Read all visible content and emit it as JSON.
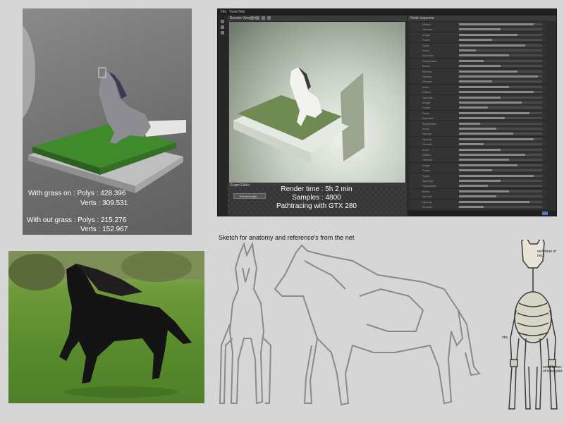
{
  "viewport_stats": {
    "with_grass_polys": "With grass on : Polys : 428.396",
    "with_grass_verts": "Verts : 309.531",
    "without_grass_polys": "With out grass : Polys : 215.276",
    "without_grass_verts": "Verts : 152.967"
  },
  "render_app": {
    "menu": [
      "File",
      "Tools",
      "Help"
    ],
    "viewer_title": "Render Viewport",
    "editor_title": "Node Inspector",
    "graph_title": "Graph Editor",
    "graph_node": "Render target",
    "render_time": "Render time : 5h 2 min",
    "samples": "Samples : 4800",
    "pathtracing": "Pathtracing with GTX 280",
    "editor_rows": [
      {
        "label": "Diffuse",
        "fill": 0.9
      },
      {
        "label": "Gamma",
        "fill": 0.5
      },
      {
        "label": "Image",
        "fill": 0.7
      },
      {
        "label": "Power",
        "fill": 0.4
      },
      {
        "label": "Scale",
        "fill": 0.8
      },
      {
        "label": "Invert",
        "fill": 0.2
      },
      {
        "label": "Specular",
        "fill": 0.6
      },
      {
        "label": "Roughness",
        "fill": 0.3
      },
      {
        "label": "Bump",
        "fill": 0.5
      },
      {
        "label": "Normal",
        "fill": 0.7
      },
      {
        "label": "Opacity",
        "fill": 0.95
      },
      {
        "label": "Smooth",
        "fill": 0.4
      },
      {
        "label": "Index",
        "fill": 0.6
      },
      {
        "label": "Diffuse",
        "fill": 0.9
      },
      {
        "label": "Gamma",
        "fill": 0.5
      },
      {
        "label": "Image",
        "fill": 0.75
      },
      {
        "label": "Power",
        "fill": 0.35
      },
      {
        "label": "Scale",
        "fill": 0.85
      },
      {
        "label": "Specular",
        "fill": 0.55
      },
      {
        "label": "Roughness",
        "fill": 0.25
      },
      {
        "label": "Bump",
        "fill": 0.45
      },
      {
        "label": "Normal",
        "fill": 0.65
      },
      {
        "label": "Opacity",
        "fill": 0.9
      },
      {
        "label": "Smooth",
        "fill": 0.3
      },
      {
        "label": "Index",
        "fill": 0.5
      },
      {
        "label": "Diffuse",
        "fill": 0.8
      },
      {
        "label": "Gamma",
        "fill": 0.6
      },
      {
        "label": "Image",
        "fill": 0.7
      },
      {
        "label": "Power",
        "fill": 0.4
      },
      {
        "label": "Scale",
        "fill": 0.9
      },
      {
        "label": "Specular",
        "fill": 0.5
      },
      {
        "label": "Roughness",
        "fill": 0.35
      },
      {
        "label": "Bump",
        "fill": 0.6
      },
      {
        "label": "Normal",
        "fill": 0.45
      },
      {
        "label": "Opacity",
        "fill": 0.85
      },
      {
        "label": "Smooth",
        "fill": 0.3
      }
    ]
  },
  "sketch_caption": "Sketch for anatomy and reference's from the net",
  "skeleton_labels": {
    "vertebrae": "vertebrae of neck",
    "ribs": "ribs",
    "small_bones": "small bones of knee joint"
  },
  "colors": {
    "background": "#d5d6d5",
    "app_bg": "#2a2a2a",
    "grass": "#3f8a2a",
    "sketch_line": "#8a8a8a"
  }
}
